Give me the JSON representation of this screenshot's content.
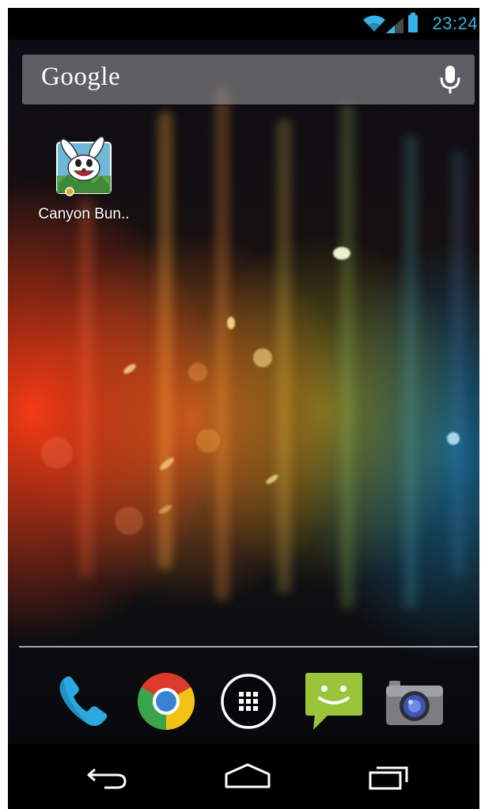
{
  "status_bar": {
    "time": "23:24",
    "icons": [
      "wifi-icon",
      "cell-signal-icon",
      "battery-icon"
    ],
    "accent_color": "#35b5e5"
  },
  "search": {
    "logo_text": "Google",
    "mic_icon": "microphone-icon"
  },
  "home_apps": [
    {
      "label": "Canyon Bun..",
      "icon": "canyon-bunny-app-icon"
    }
  ],
  "dock": [
    {
      "icon": "phone-icon"
    },
    {
      "icon": "chrome-icon"
    },
    {
      "icon": "app-drawer-icon"
    },
    {
      "icon": "messaging-icon"
    },
    {
      "icon": "camera-icon"
    }
  ],
  "nav_bar": {
    "buttons": [
      "back-icon",
      "home-icon",
      "recent-apps-icon"
    ]
  }
}
